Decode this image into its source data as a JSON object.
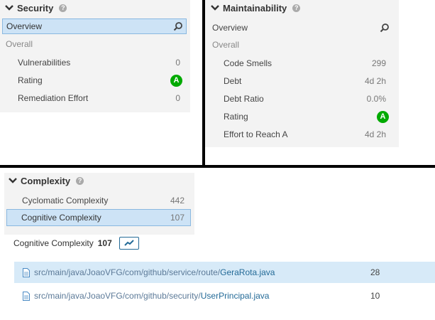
{
  "security": {
    "title": "Security",
    "overview": "Overview",
    "overall": "Overall",
    "rows": [
      {
        "label": "Vulnerabilities",
        "value": "0"
      },
      {
        "label": "Rating",
        "rating": "A"
      },
      {
        "label": "Remediation Effort",
        "value": "0"
      }
    ]
  },
  "maintainability": {
    "title": "Maintainability",
    "overview": "Overview",
    "overall": "Overall",
    "rows": [
      {
        "label": "Code Smells",
        "value": "299"
      },
      {
        "label": "Debt",
        "value": "4d 2h"
      },
      {
        "label": "Debt Ratio",
        "value": "0.0%"
      },
      {
        "label": "Rating",
        "rating": "A"
      },
      {
        "label": "Effort to Reach A",
        "value": "4d 2h"
      }
    ]
  },
  "complexity": {
    "title": "Complexity",
    "rows": [
      {
        "label": "Cyclomatic Complexity",
        "value": "442"
      },
      {
        "label": "Cognitive Complexity",
        "value": "107"
      }
    ]
  },
  "measure": {
    "label": "Cognitive Complexity",
    "value": "107"
  },
  "files": [
    {
      "path": "src/main/java/JoaoVFG/com/github/service/route/",
      "name": "GeraRota.java",
      "value": "28"
    },
    {
      "path": "src/main/java/JoaoVFG/com/github/security/",
      "name": "UserPrincipal.java",
      "value": "10"
    }
  ],
  "colors": {
    "rating_a": "#00aa00",
    "selected": "#cde3f6",
    "link": "#236a97"
  },
  "icons": {
    "collapse": "chevron-down-icon",
    "help": "help-icon",
    "search": "search-icon",
    "file": "file-icon",
    "trend": "trend-icon"
  }
}
